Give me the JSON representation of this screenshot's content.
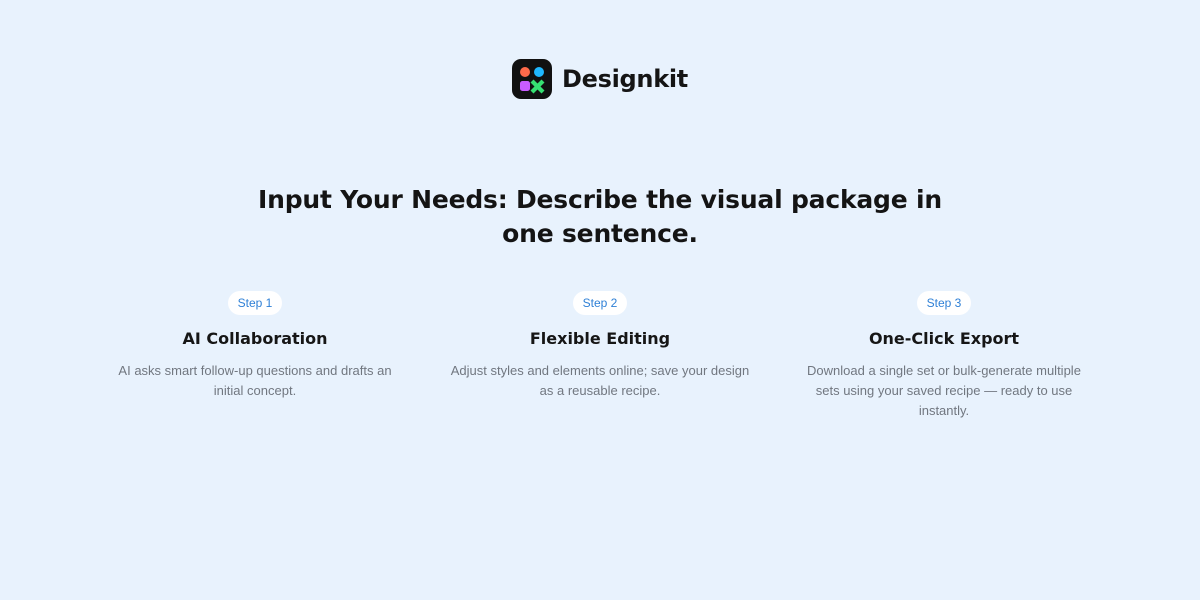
{
  "brand": {
    "name": "Designkit",
    "logo_icon": "designkit-logo-icon",
    "logo_colors": {
      "background": "#111111",
      "top_left": "#ff6a4a",
      "top_right": "#1fb8ff",
      "bottom_left": "#c85cff",
      "bottom_right": "#36e072"
    }
  },
  "headline": "Input Your Needs: Describe the visual package in one sentence.",
  "steps": [
    {
      "badge": "Step 1",
      "title": "AI Collaboration",
      "description": "AI asks smart follow-up questions and drafts an initial concept."
    },
    {
      "badge": "Step 2",
      "title": "Flexible Editing",
      "description": "Adjust styles and elements online; save your design as a reusable recipe."
    },
    {
      "badge": "Step 3",
      "title": "One-Click Export",
      "description": "Download a single set or bulk-generate multiple sets using your saved recipe — ready to use instantly."
    }
  ],
  "colors": {
    "page_background": "#e8f2fd",
    "badge_text": "#2f80d6",
    "heading_text": "#141414",
    "body_text": "#717780"
  }
}
